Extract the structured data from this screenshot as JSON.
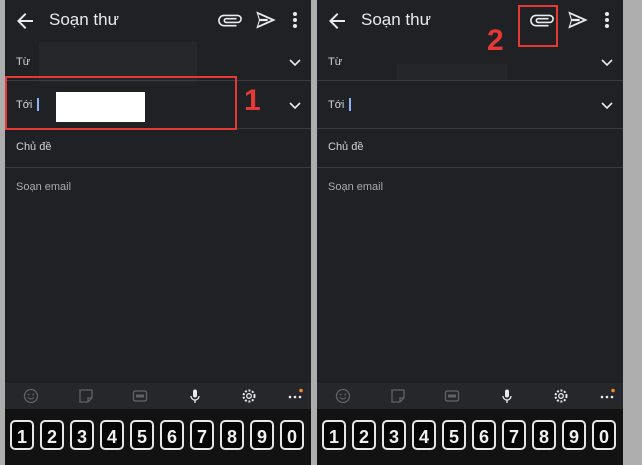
{
  "left_panel": {
    "title": "Soạn thư",
    "from_label": "Từ",
    "to_label": "Tới",
    "subject_placeholder": "Chủ đề",
    "body_placeholder": "Soạn email",
    "step_number": "1"
  },
  "right_panel": {
    "title": "Soạn thư",
    "from_label": "Từ",
    "to_label": "Tới",
    "subject_placeholder": "Chủ đề",
    "body_placeholder": "Soạn email",
    "step_number": "2"
  },
  "keyboard": {
    "digits": [
      "1",
      "2",
      "3",
      "4",
      "5",
      "6",
      "7",
      "8",
      "9",
      "0"
    ]
  },
  "toolbar_icons": [
    "emoji-icon",
    "sticker-icon",
    "gif-icon",
    "microphone-icon",
    "settings-icon",
    "more-horizontal-icon"
  ],
  "colors": {
    "background": "#202124",
    "text": "#e8eaed",
    "cursor": "#8ab4f8",
    "highlight": "#e53935",
    "notification_dot": "#f28b25"
  }
}
